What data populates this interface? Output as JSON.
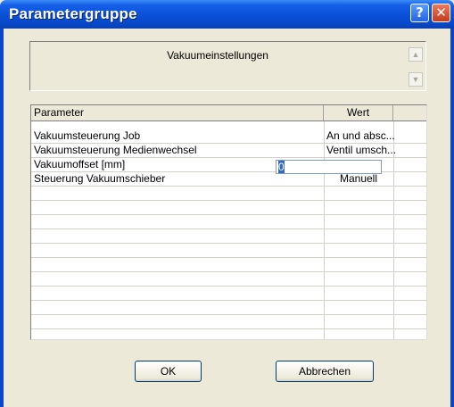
{
  "window": {
    "title": "Parametergruppe"
  },
  "group": {
    "title": "Vakuumeinstellungen"
  },
  "table": {
    "headers": {
      "parameter": "Parameter",
      "value": "Wert"
    },
    "rows": [
      {
        "param": "Vakuumsteuerung Job",
        "value": "An und absc..."
      },
      {
        "param": "Vakuumsteuerung Medienwechsel",
        "value": "Ventil umsch..."
      },
      {
        "param": "Vakuumoffset [mm]",
        "value": "0"
      },
      {
        "param": "Steuerung Vakuumschieber",
        "value": "Manuell"
      }
    ]
  },
  "buttons": {
    "ok": "OK",
    "cancel": "Abbrechen"
  },
  "icons": {
    "help": "help-icon",
    "close": "close-icon",
    "scroll_up": "arrow-up-icon",
    "scroll_down": "arrow-down-icon"
  }
}
